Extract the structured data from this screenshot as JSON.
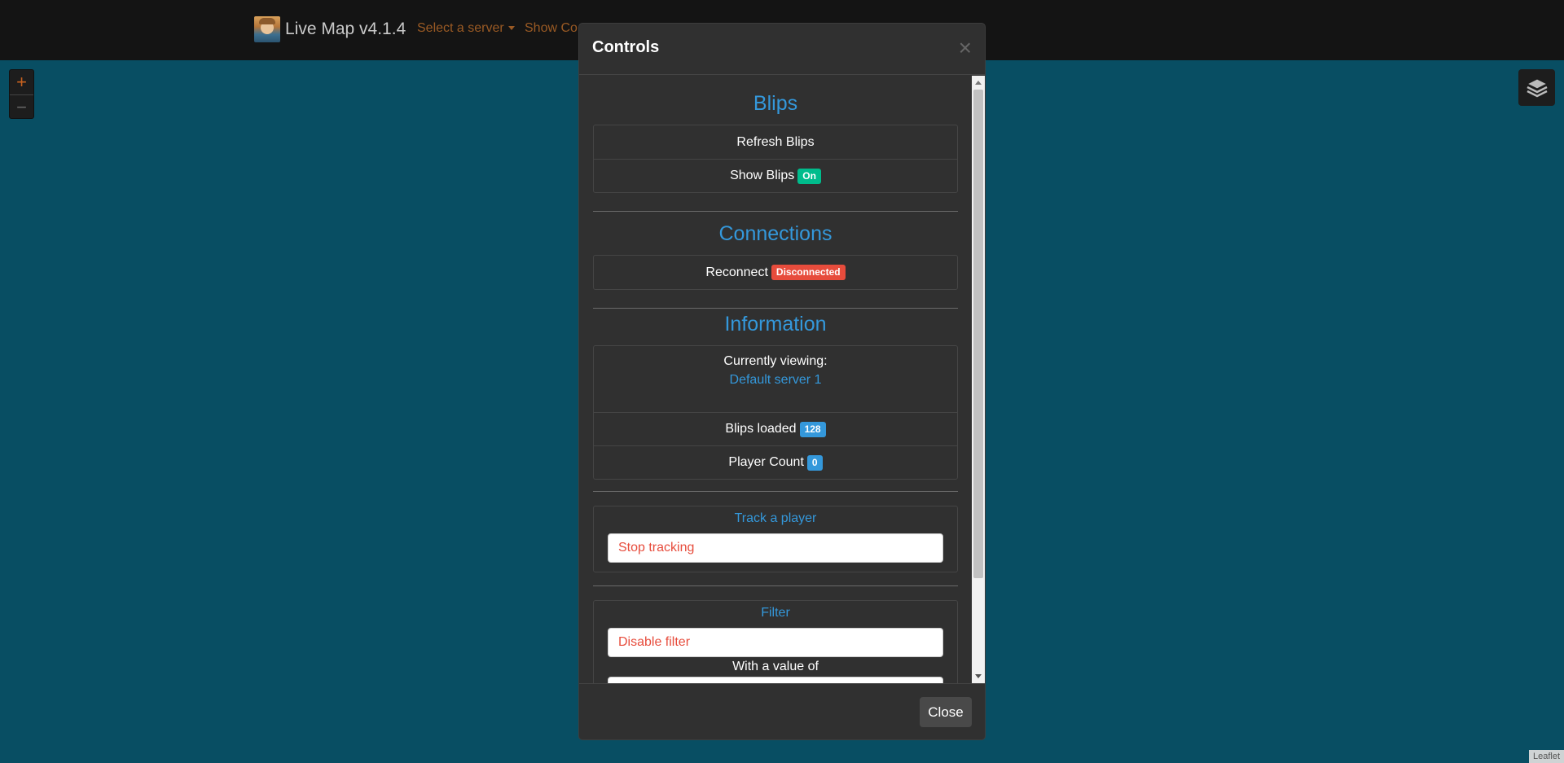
{
  "navbar": {
    "brand": "Live Map v4.1.4",
    "select_server": "Select a server",
    "show_controls": "Show Co"
  },
  "map": {
    "zoom_in": "+",
    "zoom_out": "−",
    "attribution": "Leaflet"
  },
  "modal": {
    "title": "Controls",
    "close_x": "×",
    "close_button": "Close",
    "blips": {
      "title": "Blips",
      "refresh": "Refresh Blips",
      "show": "Show Blips",
      "show_state": "On"
    },
    "connections": {
      "title": "Connections",
      "reconnect": "Reconnect",
      "status": "Disconnected"
    },
    "information": {
      "title": "Information",
      "currently_viewing": "Currently viewing:",
      "server_name": "Default server 1",
      "blips_loaded": "Blips loaded",
      "blips_count": "128",
      "player_count": "Player Count",
      "player_count_value": "0"
    },
    "track": {
      "title": "Track a player",
      "select_value": "Stop tracking"
    },
    "filter": {
      "title": "Filter",
      "select_value": "Disable filter",
      "value_label": "With a value of"
    }
  },
  "colors": {
    "accent_blue": "#3498db",
    "success": "#00bc8c",
    "danger": "#e74c3c",
    "map_water": "#084e63"
  }
}
